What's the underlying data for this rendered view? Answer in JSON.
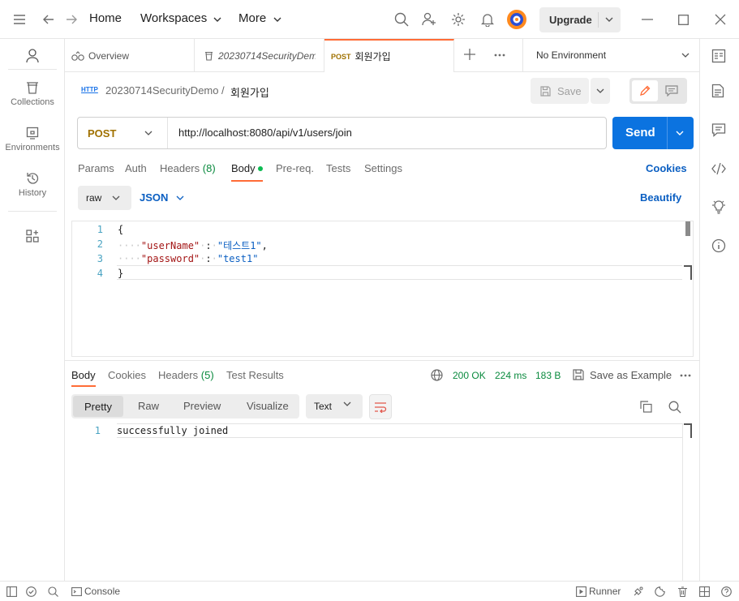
{
  "topbar": {
    "home": "Home",
    "workspaces": "Workspaces",
    "more": "More",
    "upgrade": "Upgrade"
  },
  "sidebar": {
    "items": [
      {
        "label": "Collections",
        "icon": "trash-can-icon"
      },
      {
        "label": "Environments",
        "icon": "environments-icon"
      },
      {
        "label": "History",
        "icon": "history-icon"
      }
    ]
  },
  "tabs": {
    "overview": "Overview",
    "collection": "20230714SecurityDemo",
    "request_method": "POST",
    "request_name": "회원가입",
    "environment": "No Environment"
  },
  "breadcrumb": {
    "icon_text": "HTTP",
    "collection": "20230714SecurityDemo",
    "separator": "/",
    "request": "회원가입",
    "save": "Save"
  },
  "request": {
    "method": "POST",
    "url": "http://localhost:8080/api/v1/users/join",
    "send": "Send",
    "tabs": {
      "params": "Params",
      "auth": "Auth",
      "headers": "Headers",
      "headers_count": "(8)",
      "body": "Body",
      "prereq": "Pre-req.",
      "tests": "Tests",
      "settings": "Settings"
    },
    "cookies": "Cookies",
    "body_mode": "raw",
    "body_lang": "JSON",
    "beautify": "Beautify",
    "lines": [
      "1",
      "2",
      "3",
      "4"
    ],
    "code": {
      "open": "{",
      "key1": "\"userName\"",
      "val1": "\"테스트1\"",
      "key2": "\"password\"",
      "val2": "\"test1\"",
      "close": "}"
    }
  },
  "response": {
    "tabs": {
      "body": "Body",
      "cookies": "Cookies",
      "headers": "Headers",
      "headers_count": "(5)",
      "test_results": "Test Results"
    },
    "status": "200 OK",
    "time": "224 ms",
    "size": "183 B",
    "save_example": "Save as Example",
    "views": [
      "Pretty",
      "Raw",
      "Preview",
      "Visualize"
    ],
    "format": "Text",
    "line_no": "1",
    "body_text": "successfully joined"
  },
  "statusbar": {
    "console": "Console",
    "runner": "Runner"
  }
}
